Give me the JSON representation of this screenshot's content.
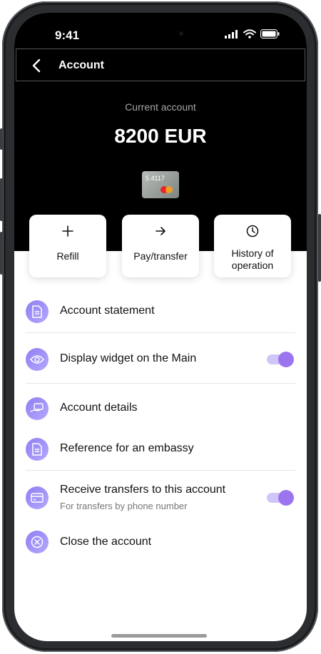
{
  "status": {
    "time": "9:41"
  },
  "header": {
    "title": "Account",
    "back_icon": "chevron-left-icon"
  },
  "account": {
    "label": "Current account",
    "balance": "8200 EUR",
    "card_number": "5.4117",
    "card_brand_icon": "mastercard-icon"
  },
  "actions": [
    {
      "label": "Refill",
      "icon": "plus-icon"
    },
    {
      "label": "Pay/transfer",
      "icon": "arrow-right-icon"
    },
    {
      "label": "History of operation",
      "icon": "clock-icon"
    }
  ],
  "menu": {
    "items": [
      {
        "label": "Account statement",
        "icon": "document-icon"
      },
      {
        "label": "Display widget on the Main",
        "icon": "eye-icon",
        "toggle": true
      },
      {
        "label": "Account details",
        "icon": "card-hand-icon"
      },
      {
        "label": "Reference for an embassy",
        "icon": "document-icon"
      },
      {
        "label": "Receive transfers to this account",
        "sublabel": "For transfers by phone number",
        "icon": "card-icon",
        "toggle": true
      },
      {
        "label": "Close the account",
        "icon": "close-circle-icon"
      }
    ]
  },
  "colors": {
    "accent": "#9b75ef",
    "icon_bg": "#a092f6",
    "dark_bg": "#000000"
  }
}
